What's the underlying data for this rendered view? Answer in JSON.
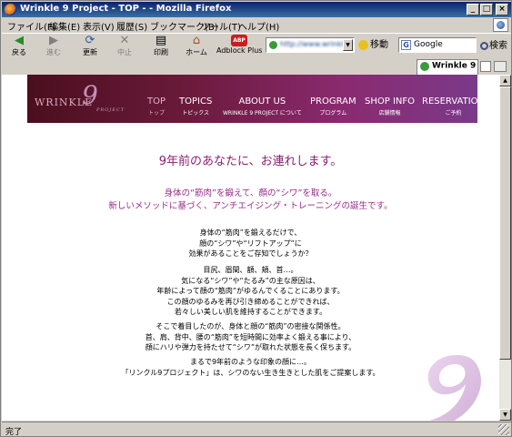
{
  "window": {
    "title": "Wrinkle 9 Project - TOP - - Mozilla Firefox"
  },
  "menubar": {
    "items": [
      "ファイル(F)",
      "編集(E)",
      "表示(V)",
      "履歴(S)",
      "ブックマーク(B)",
      "ツール(T)",
      "ヘルプ(H)"
    ]
  },
  "navbar": {
    "back": "戻る",
    "forward": "進む",
    "reload": "更新",
    "stop": "中止",
    "print": "印刷",
    "home": "ホーム",
    "adblock": "Adblock Plus",
    "adblock_badge": "ABP",
    "url": "http://www.wrinkle9",
    "go": "移動",
    "search_value": "Google",
    "search_btn": "検索"
  },
  "tab": {
    "title": "Wrinkle 9 ..."
  },
  "site": {
    "logo": "WRINKLE",
    "logo_nine": "9",
    "logo_project": "PROJECT",
    "nav": [
      {
        "en": "TOP",
        "jp": "トップ"
      },
      {
        "en": "TOPICS",
        "jp": "トピックス"
      },
      {
        "en": "ABOUT US",
        "jp": "WRINKLE 9 PROJECT について"
      },
      {
        "en": "PROGRAM",
        "jp": "プログラム"
      },
      {
        "en": "SHOP INFO",
        "jp": "店舗情報"
      },
      {
        "en": "RESERVATION",
        "jp": "ご予約"
      }
    ],
    "headline": "9年前のあなたに、お連れします。",
    "lead": [
      "身体の“筋肉”を鍛えて、顔の“シワ”を取る。",
      "新しいメソッドに基づく、アンチエイジング・トレーニングの誕生です。"
    ],
    "para1": [
      "身体の“筋肉”を鍛えるだけで、",
      "顔の“シワ”や“リフトアップ”に",
      "効果があることをご存知でしょうか？"
    ],
    "para2": [
      "目尻、眉間、額、頬、首…。",
      "気になる“シワ”や“たるみ”の主な原因は、",
      "年齢によって顔の“筋肉”がゆるんでくることにあります。",
      "この顔のゆるみを再び引き締めることができれば、",
      "若々しい美しい肌を維持することができます。"
    ],
    "para3": [
      "そこで着目したのが、身体と顔の“筋肉”の密接な関係性。",
      "首、肩、背中、腰の“筋肉”を短時間に効率よく鍛える事により、",
      "顔にハリや弾力を持たせて“シワ”が取れた状態を長く保ちます。"
    ],
    "para4": [
      "まるで9年前のような印象の顔に…。",
      "「リンクル9プロジェクト」は、シワのない生き生きとした肌をご提案します。"
    ],
    "deco": "9"
  },
  "status": {
    "text": "完了"
  },
  "colors": {
    "banner": "#6a1a3a",
    "headline": "#8a2070",
    "lead": "#9a2a8a"
  }
}
